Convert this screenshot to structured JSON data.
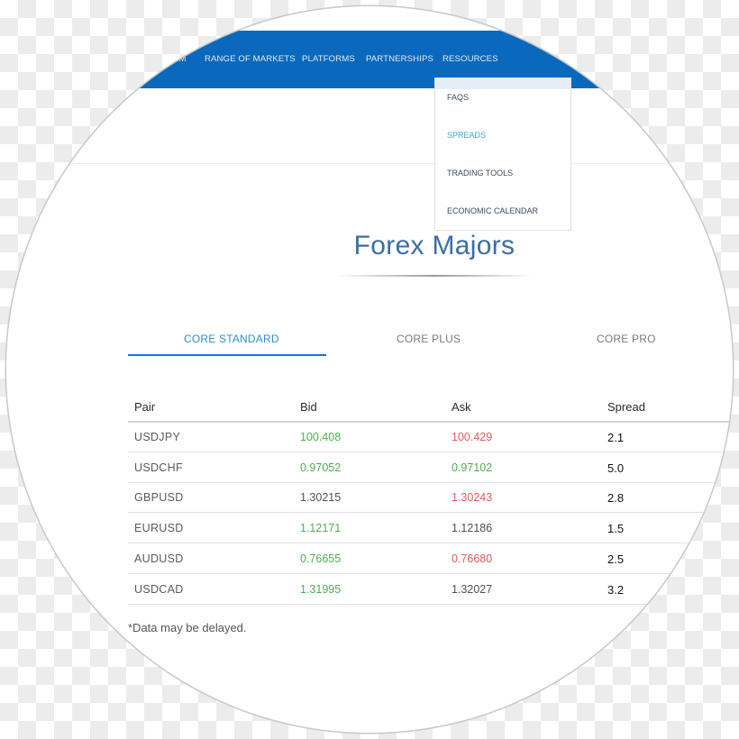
{
  "nav": {
    "items": [
      {
        "label": "EM",
        "truncated": true
      },
      {
        "label": "RANGE OF MARKETS"
      },
      {
        "label": "PLATFORMS"
      },
      {
        "label": "PARTNERSHIPS"
      },
      {
        "label": "RESOURCES"
      }
    ],
    "resources_dropdown": [
      {
        "label": "FAQS",
        "active": false
      },
      {
        "label": "SPREADS",
        "active": true
      },
      {
        "label": "TRADING TOOLS",
        "active": false
      },
      {
        "label": "ECONOMIC CALENDAR",
        "active": false
      }
    ]
  },
  "page_title": "Forex Majors",
  "tabs": [
    {
      "label": "CORE STANDARD",
      "active": true
    },
    {
      "label": "CORE PLUS",
      "active": false
    },
    {
      "label": "CORE PRO",
      "active": false
    }
  ],
  "table": {
    "columns": [
      "Pair",
      "Bid",
      "Ask",
      "Spread"
    ],
    "rows": [
      {
        "pair": "USDJPY",
        "bid": "100.408",
        "bid_trend": "up",
        "ask": "100.429",
        "ask_trend": "down",
        "spread": "2.1"
      },
      {
        "pair": "USDCHF",
        "bid": "0.97052",
        "bid_trend": "up",
        "ask": "0.97102",
        "ask_trend": "up",
        "spread": "5.0"
      },
      {
        "pair": "GBPUSD",
        "bid": "1.30215",
        "bid_trend": "neutral",
        "ask": "1.30243",
        "ask_trend": "down",
        "spread": "2.8"
      },
      {
        "pair": "EURUSD",
        "bid": "1.12171",
        "bid_trend": "up",
        "ask": "1.12186",
        "ask_trend": "neutral",
        "spread": "1.5"
      },
      {
        "pair": "AUDUSD",
        "bid": "0.76655",
        "bid_trend": "up",
        "ask": "0.76680",
        "ask_trend": "down",
        "spread": "2.5"
      },
      {
        "pair": "USDCAD",
        "bid": "1.31995",
        "bid_trend": "up",
        "ask": "1.32027",
        "ask_trend": "neutral",
        "spread": "3.2"
      }
    ]
  },
  "footnote": "*Data may be delayed.",
  "colors": {
    "brand_blue": "#0a68bd",
    "active_link": "#3aa3dc",
    "price_up": "#4caf50",
    "price_down": "#e35a5a"
  }
}
